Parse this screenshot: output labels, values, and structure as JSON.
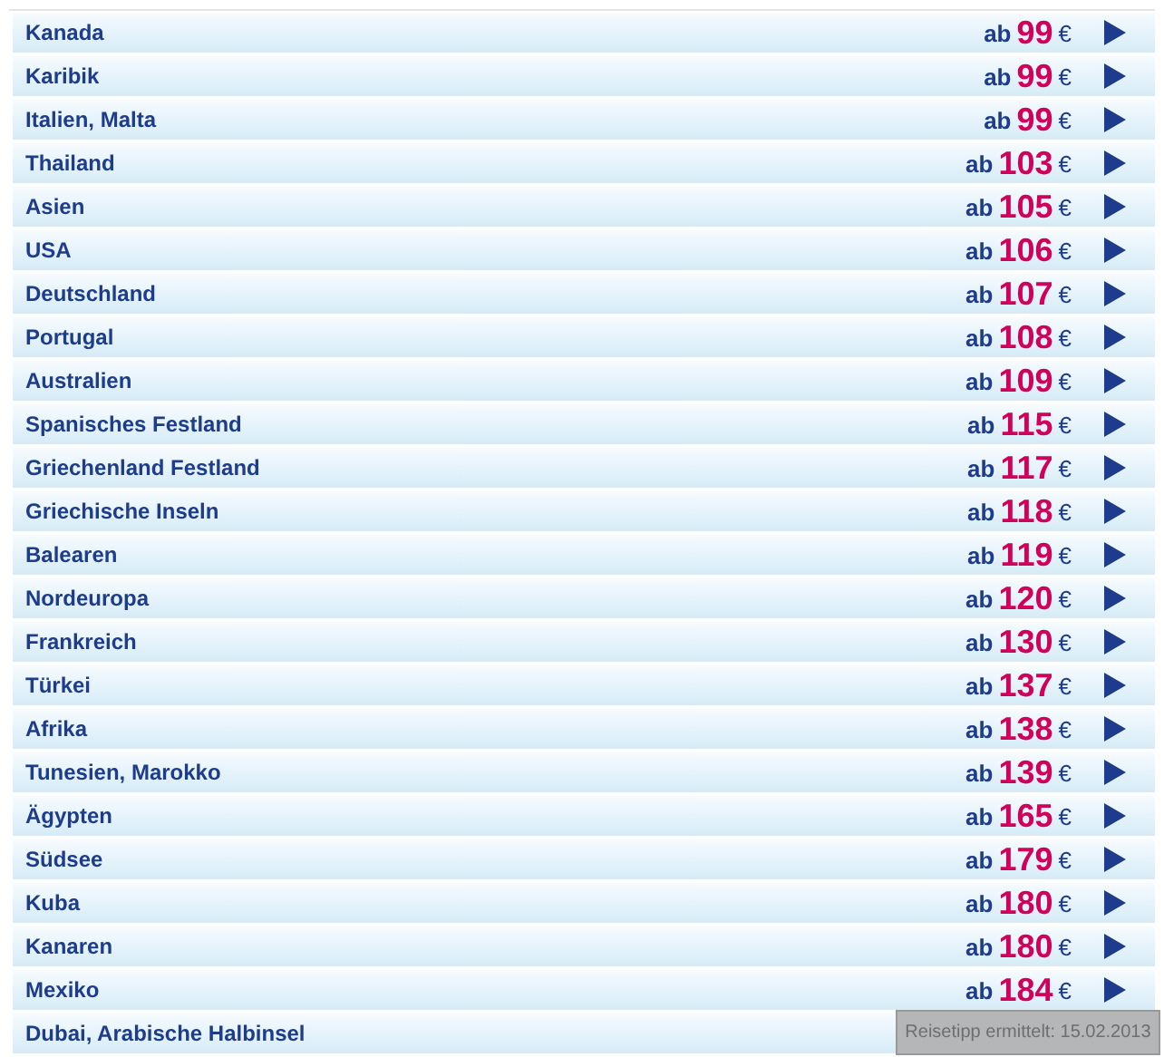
{
  "rows": [
    {
      "name": "Kanada",
      "prefix": "ab",
      "price": "99",
      "currency": "€"
    },
    {
      "name": "Karibik",
      "prefix": "ab",
      "price": "99",
      "currency": "€"
    },
    {
      "name": "Italien, Malta",
      "prefix": "ab",
      "price": "99",
      "currency": "€"
    },
    {
      "name": "Thailand",
      "prefix": "ab",
      "price": "103",
      "currency": "€"
    },
    {
      "name": "Asien",
      "prefix": "ab",
      "price": "105",
      "currency": "€"
    },
    {
      "name": "USA",
      "prefix": "ab",
      "price": "106",
      "currency": "€"
    },
    {
      "name": "Deutschland",
      "prefix": "ab",
      "price": "107",
      "currency": "€"
    },
    {
      "name": "Portugal",
      "prefix": "ab",
      "price": "108",
      "currency": "€"
    },
    {
      "name": "Australien",
      "prefix": "ab",
      "price": "109",
      "currency": "€"
    },
    {
      "name": "Spanisches Festland",
      "prefix": "ab",
      "price": "115",
      "currency": "€"
    },
    {
      "name": "Griechenland Festland",
      "prefix": "ab",
      "price": "117",
      "currency": "€"
    },
    {
      "name": "Griechische Inseln",
      "prefix": "ab",
      "price": "118",
      "currency": "€"
    },
    {
      "name": "Balearen",
      "prefix": "ab",
      "price": "119",
      "currency": "€"
    },
    {
      "name": "Nordeuropa",
      "prefix": "ab",
      "price": "120",
      "currency": "€"
    },
    {
      "name": "Frankreich",
      "prefix": "ab",
      "price": "130",
      "currency": "€"
    },
    {
      "name": "Türkei",
      "prefix": "ab",
      "price": "137",
      "currency": "€"
    },
    {
      "name": "Afrika",
      "prefix": "ab",
      "price": "138",
      "currency": "€"
    },
    {
      "name": "Tunesien, Marokko",
      "prefix": "ab",
      "price": "139",
      "currency": "€"
    },
    {
      "name": "Ägypten",
      "prefix": "ab",
      "price": "165",
      "currency": "€"
    },
    {
      "name": "Südsee",
      "prefix": "ab",
      "price": "179",
      "currency": "€"
    },
    {
      "name": "Kuba",
      "prefix": "ab",
      "price": "180",
      "currency": "€"
    },
    {
      "name": "Kanaren",
      "prefix": "ab",
      "price": "180",
      "currency": "€"
    },
    {
      "name": "Mexiko",
      "prefix": "ab",
      "price": "184",
      "currency": "€"
    },
    {
      "name": "Dubai, Arabische Halbinsel"
    }
  ],
  "tooltip": {
    "text": "Reisetipp ermittelt: 15.02.2013"
  }
}
